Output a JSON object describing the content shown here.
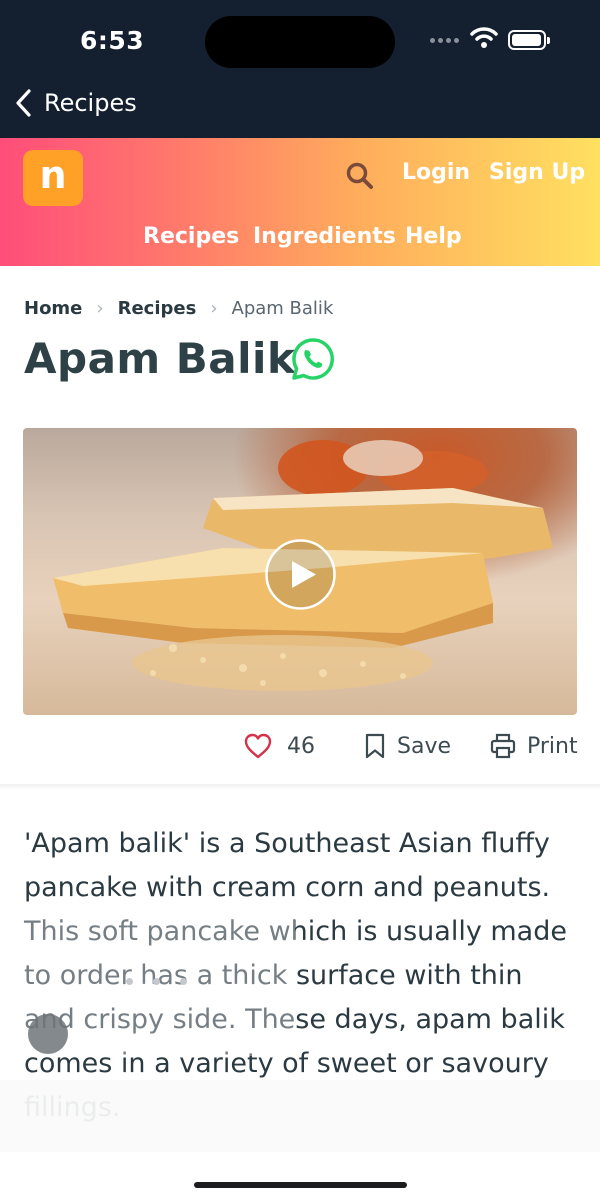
{
  "status": {
    "time": "6:53"
  },
  "nav": {
    "back_label": "Recipes"
  },
  "header": {
    "logo_letter": "n",
    "login": "Login",
    "signup": "Sign Up",
    "menu": [
      "Recipes",
      "Ingredients",
      "Help"
    ],
    "gradient_colors": [
      "#ff4d7a",
      "#ffe060"
    ]
  },
  "breadcrumb": {
    "home": "Home",
    "recipes": "Recipes",
    "current": "Apam Balik"
  },
  "recipe": {
    "title": "Apam Balik",
    "likes": "46",
    "save_label": "Save",
    "print_label": "Print",
    "description": "'Apam balik' is a Southeast Asian fluffy pancake with cream corn and peanuts. This soft pancake which is usually made to order has a thick surface with thin and crispy side. These days, apam balik comes in a variety of sweet or savoury fillings."
  },
  "icons": [
    "chevron-left-icon",
    "search-icon",
    "whatsapp-icon",
    "play-icon",
    "heart-icon",
    "bookmark-icon",
    "printer-icon"
  ],
  "colors": {
    "nav_bg": "#14202f",
    "whatsapp": "#25d366",
    "heart": "#d6334a"
  }
}
